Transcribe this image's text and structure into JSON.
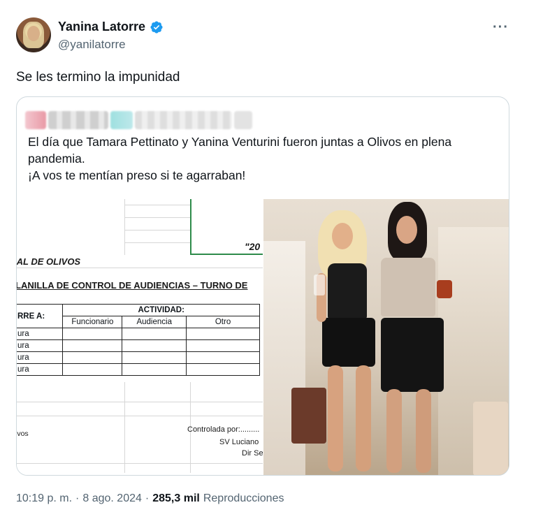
{
  "author": {
    "display_name": "Yanina Latorre",
    "handle": "@yanilatorre",
    "verified": true,
    "verified_color": "#1d9bf0"
  },
  "tweet": {
    "text": "Se les termino la impunidad"
  },
  "quoted_tweet": {
    "text_line1": "El día que Tamara Pettinato y Yanina Venturini fueron juntas a Olivos en plena pandemia.",
    "text_line2": "¡A vos te mentían preso si te agarraban!",
    "document": {
      "year": "\"20",
      "org": "IAL DE OLIVOS",
      "title": "LANILLA DE CONTROL DE AUDIENCIAS – TURNO DE",
      "col_a": "RRE A:",
      "activity": "ACTIVIDAD:",
      "headers": [
        "Funcionario",
        "Audiencia",
        "Otro"
      ],
      "rows": [
        "ura",
        "ura",
        "ura",
        "ura"
      ],
      "footer_left": "ivos",
      "controlled_by": "Controlada por:.........",
      "sv": "SV Luciano",
      "dir": "Dir Se"
    }
  },
  "footer": {
    "time": "10:19 p. m.",
    "sep1": "·",
    "date": "8 ago. 2024",
    "sep2": "·",
    "views_count": "285,3 mil",
    "views_label": "Reproducciones"
  },
  "menu": {
    "more_label": "···"
  }
}
